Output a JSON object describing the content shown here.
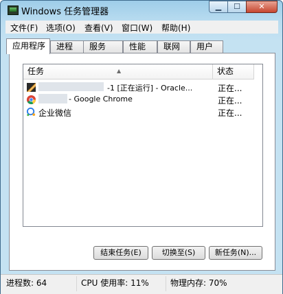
{
  "window": {
    "title": "Windows 任务管理器"
  },
  "titlebar": {
    "minimize": "▁",
    "maximize": "☐",
    "close": "✕"
  },
  "menu": [
    "文件(F)",
    "选项(O)",
    "查看(V)",
    "窗口(W)",
    "帮助(H)"
  ],
  "tabs": [
    "应用程序",
    "进程",
    "服务",
    "性能",
    "联网",
    "用户"
  ],
  "list": {
    "columns": {
      "task": "任务",
      "status": "状态"
    },
    "rows": [
      {
        "task": "-1 [正在运行] - Oracle...",
        "status": "正在...",
        "icon": "virtualbox-icon"
      },
      {
        "task": " - Google Chrome",
        "status": "正在...",
        "icon": "chrome-icon"
      },
      {
        "task": "企业微信",
        "status": "正在...",
        "icon": "wecom-icon"
      }
    ]
  },
  "buttons": {
    "end_task": "结束任务(E)",
    "switch_to": "切换至(S)",
    "new_task": "新任务(N)..."
  },
  "statusbar": {
    "processes": "进程数: 64",
    "cpu": "CPU 使用率: 11%",
    "memory": "物理内存: 70%"
  }
}
